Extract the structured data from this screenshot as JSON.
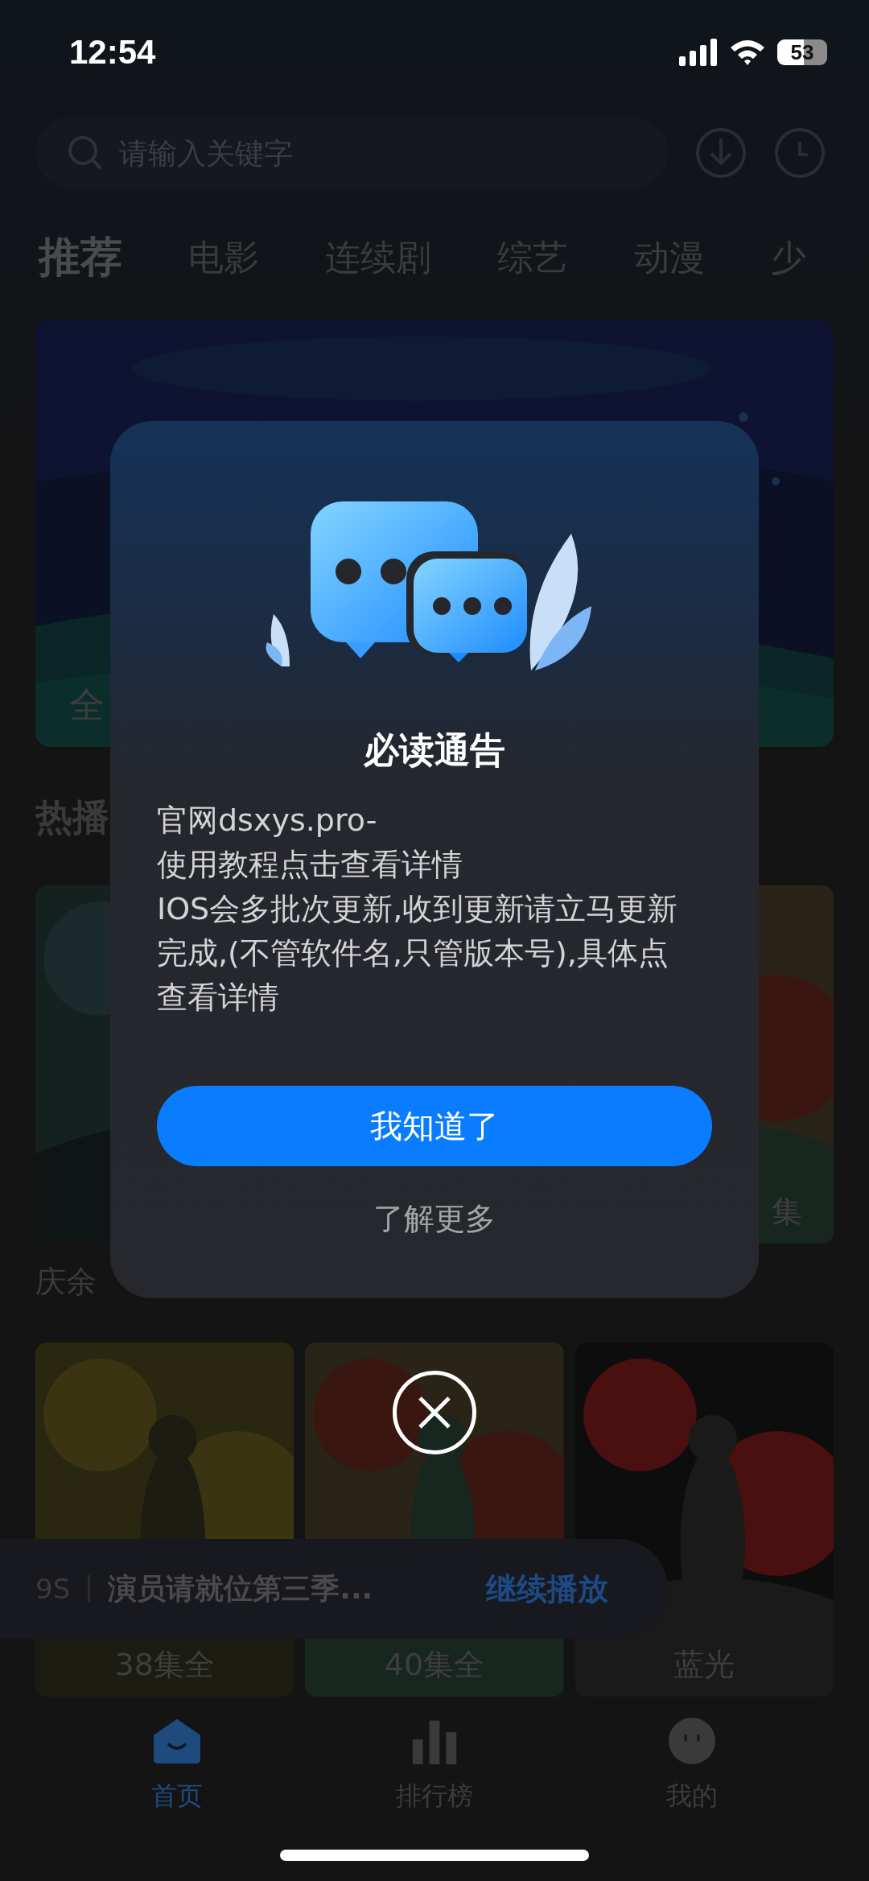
{
  "status_bar": {
    "time": "12:54",
    "battery": "53"
  },
  "search": {
    "placeholder": "请输入关键字"
  },
  "tabs": [
    {
      "label": "推荐",
      "selected": true
    },
    {
      "label": "电影",
      "selected": false
    },
    {
      "label": "连续剧",
      "selected": false
    },
    {
      "label": "综艺",
      "selected": false
    },
    {
      "label": "动漫",
      "selected": false
    },
    {
      "label": "少",
      "selected": false
    }
  ],
  "banner": {
    "kind": "picture",
    "caption": "全"
  },
  "section": {
    "title": "热播"
  },
  "hot_posters": [
    {
      "title": "庆余"
    },
    {
      "badge": "集"
    }
  ],
  "posters": [
    {
      "badge": "38集全"
    },
    {
      "badge": "40集全"
    },
    {
      "badge": "蓝光"
    }
  ],
  "continue_bar": {
    "time": "9S",
    "title": "演员请就位第三季...",
    "action": "继续播放"
  },
  "nav": [
    {
      "label": "首页",
      "selected": true,
      "kind": "home"
    },
    {
      "label": "排行榜",
      "selected": false,
      "kind": "chart"
    },
    {
      "label": "我的",
      "selected": false,
      "kind": "face"
    }
  ],
  "dialog": {
    "title": "必读通告",
    "paragraphs": [
      "官网dsxys.pro-",
      "使用教程点击查看详情",
      "IOS会多批次更新,收到更新请立马更新完成,(不管软件名,只管版本号),具体点查看详情"
    ],
    "primary_button": "我知道了",
    "secondary_button": "了解更多"
  }
}
